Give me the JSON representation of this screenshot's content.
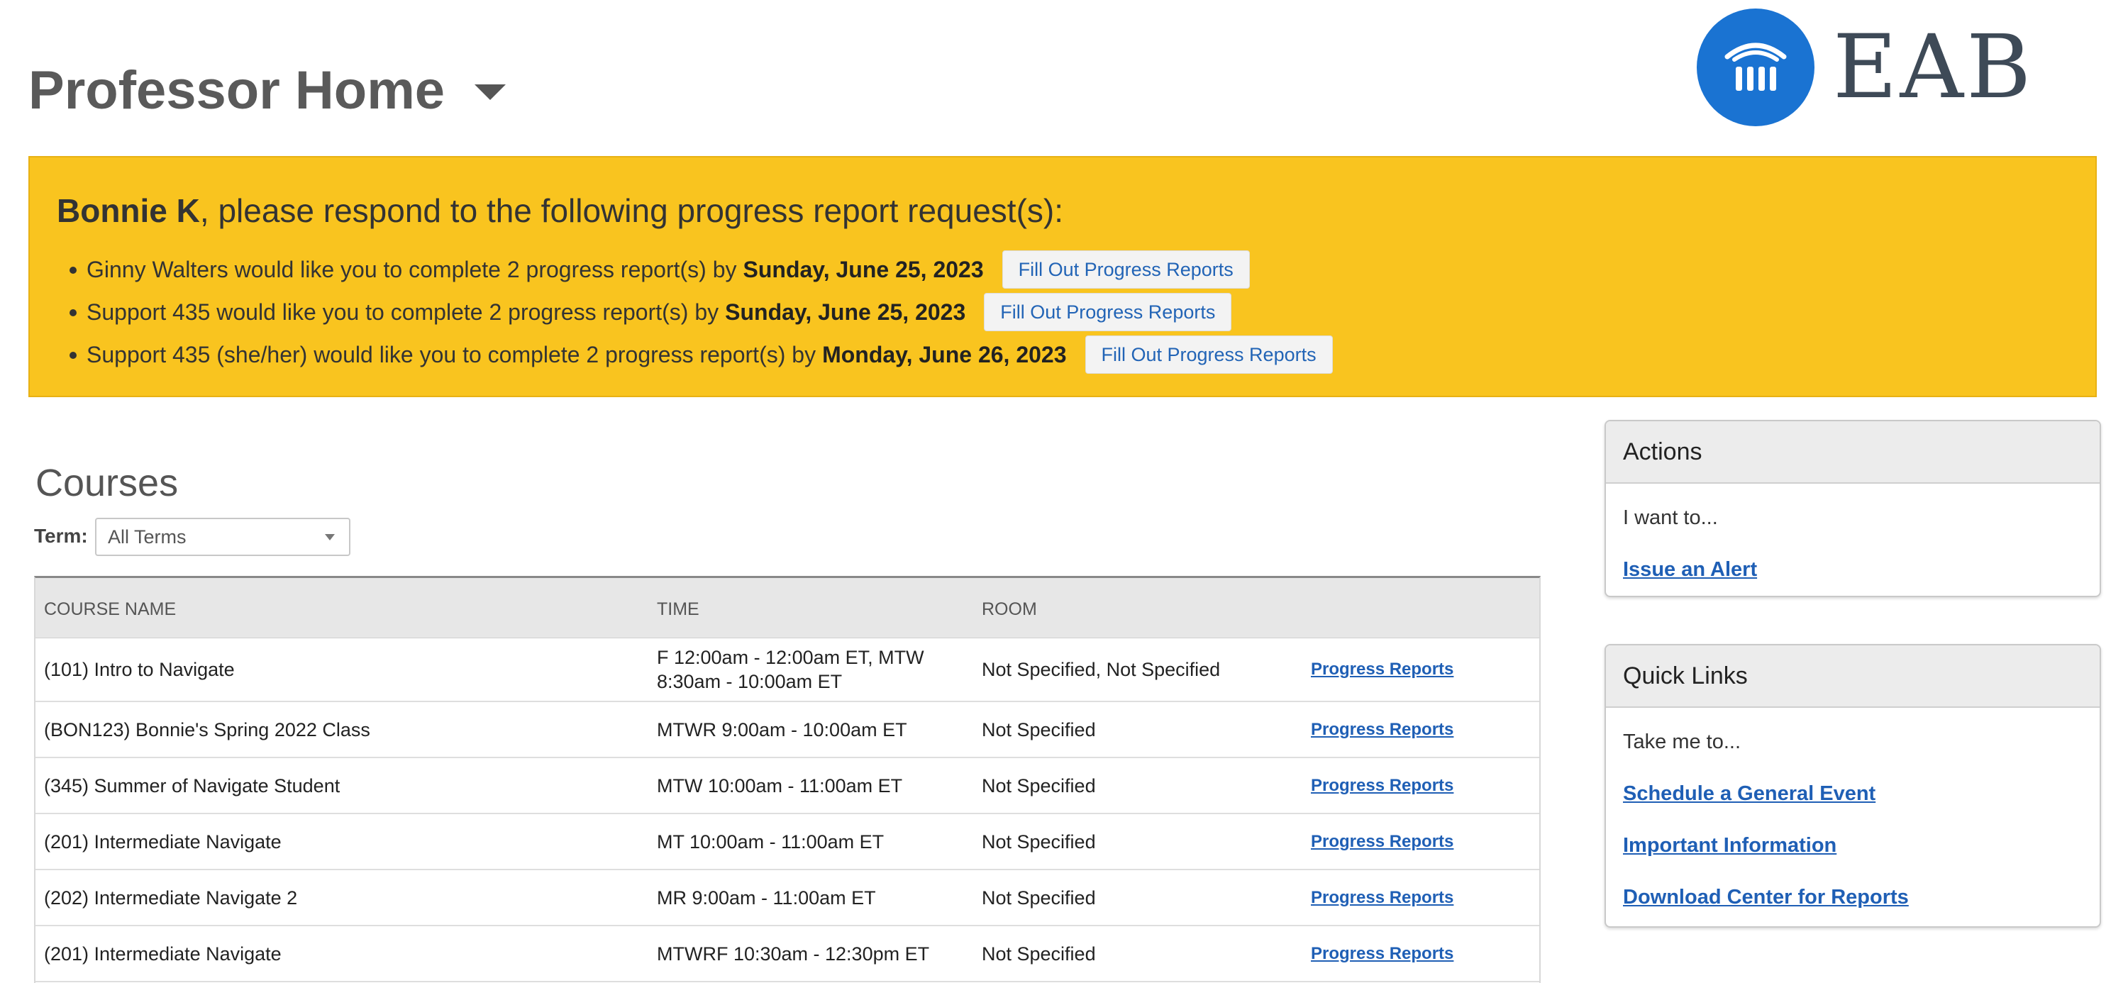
{
  "header": {
    "title": "Professor Home",
    "logo_text": "EAB"
  },
  "banner": {
    "user_name": "Bonnie K",
    "heading_rest": ", please respond to the following progress report request(s):",
    "requests": [
      {
        "text": "Ginny Walters would like you to complete 2 progress report(s) by",
        "date": "Sunday, June 25, 2023",
        "button": "Fill Out Progress Reports"
      },
      {
        "text": "Support 435 would like you to complete 2 progress report(s) by",
        "date": "Sunday, June 25, 2023",
        "button": "Fill Out Progress Reports"
      },
      {
        "text": "Support 435 (she/her) would like you to complete 2 progress report(s) by",
        "date": "Monday, June 26, 2023",
        "button": "Fill Out Progress Reports"
      }
    ]
  },
  "courses": {
    "title": "Courses",
    "term_label": "Term:",
    "term_value": "All Terms",
    "columns": [
      "COURSE NAME",
      "TIME",
      "ROOM"
    ],
    "rows": [
      {
        "name": "(101) Intro to Navigate",
        "time": "F 12:00am - 12:00am ET, MTW 8:30am - 10:00am ET",
        "room": "Not Specified, Not Specified",
        "link": "Progress Reports"
      },
      {
        "name": "(BON123) Bonnie's Spring 2022 Class",
        "time": "MTWR 9:00am - 10:00am ET",
        "room": "Not Specified",
        "link": "Progress Reports"
      },
      {
        "name": "(345) Summer of Navigate Student",
        "time": "MTW 10:00am - 11:00am ET",
        "room": "Not Specified",
        "link": "Progress Reports"
      },
      {
        "name": "(201) Intermediate Navigate",
        "time": "MT 10:00am - 11:00am ET",
        "room": "Not Specified",
        "link": "Progress Reports"
      },
      {
        "name": "(202) Intermediate Navigate 2",
        "time": "MR 9:00am - 11:00am ET",
        "room": "Not Specified",
        "link": "Progress Reports"
      },
      {
        "name": "(201) Intermediate Navigate",
        "time": "MTWRF 10:30am - 12:30pm ET",
        "room": "Not Specified",
        "link": "Progress Reports"
      }
    ]
  },
  "actions_panel": {
    "title": "Actions",
    "subtitle": "I want to...",
    "links": [
      "Issue an Alert"
    ]
  },
  "quick_links_panel": {
    "title": "Quick Links",
    "subtitle": "Take me to...",
    "links": [
      "Schedule a General Event",
      "Important Information",
      "Download Center for Reports"
    ]
  },
  "colors": {
    "banner_bg": "#f9c41f",
    "logo_blue": "#1a73d2",
    "link_blue": "#1f5fb5"
  }
}
